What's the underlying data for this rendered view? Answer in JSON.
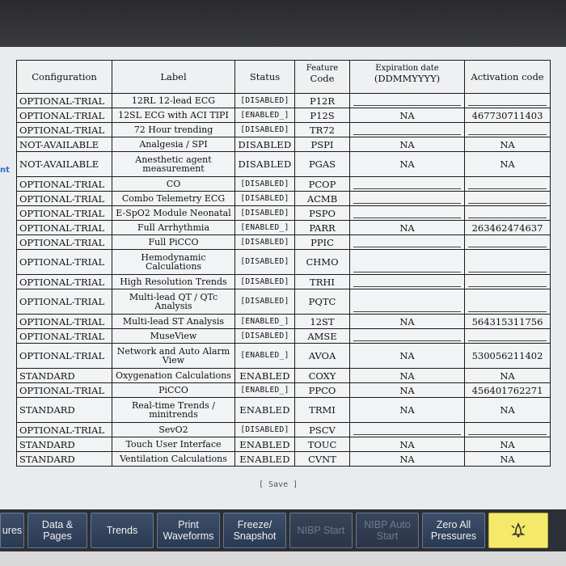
{
  "side_label": "nt",
  "columns": {
    "configuration": "Configuration",
    "label": "Label",
    "status": "Status",
    "feature_code_top": "Feature",
    "feature_code": "Code",
    "expiration_top": "Expiration date",
    "expiration": "(DDMMYYYY)",
    "activation": "Activation code"
  },
  "rows": [
    {
      "cfg": "OPTIONAL-TRIAL",
      "label": "12RL 12-lead ECG",
      "status": "[DISABLED]",
      "code": "P12R",
      "exp": "",
      "act": ""
    },
    {
      "cfg": "OPTIONAL-TRIAL",
      "label": "12SL ECG with ACI TIPI",
      "status": "[ENABLED_]",
      "code": "P12S",
      "exp": "NA",
      "act": "467730711403"
    },
    {
      "cfg": "OPTIONAL-TRIAL",
      "label": "72 Hour trending",
      "status": "[DISABLED]",
      "code": "TR72",
      "exp": "",
      "act": ""
    },
    {
      "cfg": "NOT-AVAILABLE",
      "label": "Analgesia / SPI",
      "status": "DISABLED",
      "code": "PSPI",
      "exp": "NA",
      "act": "NA"
    },
    {
      "cfg": "NOT-AVAILABLE",
      "label": "Anesthetic agent measurement",
      "status": "DISABLED",
      "code": "PGAS",
      "exp": "NA",
      "act": "NA"
    },
    {
      "cfg": "OPTIONAL-TRIAL",
      "label": "CO",
      "status": "[DISABLED]",
      "code": "PCOP",
      "exp": "",
      "act": ""
    },
    {
      "cfg": "OPTIONAL-TRIAL",
      "label": "Combo Telemetry ECG",
      "status": "[DISABLED]",
      "code": "ACMB",
      "exp": "",
      "act": ""
    },
    {
      "cfg": "OPTIONAL-TRIAL",
      "label": "E-SpO2 Module Neonatal",
      "status": "[DISABLED]",
      "code": "PSPO",
      "exp": "",
      "act": ""
    },
    {
      "cfg": "OPTIONAL-TRIAL",
      "label": "Full Arrhythmia",
      "status": "[ENABLED_]",
      "code": "PARR",
      "exp": "NA",
      "act": "263462474637"
    },
    {
      "cfg": "OPTIONAL-TRIAL",
      "label": "Full PiCCO",
      "status": "[DISABLED]",
      "code": "PPIC",
      "exp": "",
      "act": ""
    },
    {
      "cfg": "OPTIONAL-TRIAL",
      "label": "Hemodynamic Calculations",
      "status": "[DISABLED]",
      "code": "CHMO",
      "exp": "",
      "act": ""
    },
    {
      "cfg": "OPTIONAL-TRIAL",
      "label": "High Resolution Trends",
      "status": "[DISABLED]",
      "code": "TRHI",
      "exp": "",
      "act": ""
    },
    {
      "cfg": "OPTIONAL-TRIAL",
      "label": "Multi-lead QT / QTc Analysis",
      "status": "[DISABLED]",
      "code": "PQTC",
      "exp": "",
      "act": ""
    },
    {
      "cfg": "OPTIONAL-TRIAL",
      "label": "Multi-lead ST Analysis",
      "status": "[ENABLED_]",
      "code": "12ST",
      "exp": "NA",
      "act": "564315311756"
    },
    {
      "cfg": "OPTIONAL-TRIAL",
      "label": "MuseView",
      "status": "[DISABLED]",
      "code": "AMSE",
      "exp": "",
      "act": ""
    },
    {
      "cfg": "OPTIONAL-TRIAL",
      "label": "Network and Auto Alarm View",
      "status": "[ENABLED_]",
      "code": "AVOA",
      "exp": "NA",
      "act": "530056211402"
    },
    {
      "cfg": "STANDARD",
      "label": "Oxygenation Calculations",
      "status": "ENABLED",
      "code": "COXY",
      "exp": "NA",
      "act": "NA"
    },
    {
      "cfg": "OPTIONAL-TRIAL",
      "label": "PiCCO",
      "status": "[ENABLED_]",
      "code": "PPCO",
      "exp": "NA",
      "act": "456401762271"
    },
    {
      "cfg": "STANDARD",
      "label": "Real-time Trends / minitrends",
      "status": "ENABLED",
      "code": "TRMI",
      "exp": "NA",
      "act": "NA"
    },
    {
      "cfg": "OPTIONAL-TRIAL",
      "label": "SevO2",
      "status": "[DISABLED]",
      "code": "PSCV",
      "exp": "",
      "act": ""
    },
    {
      "cfg": "STANDARD",
      "label": "Touch User Interface",
      "status": "ENABLED",
      "code": "TOUC",
      "exp": "NA",
      "act": "NA"
    },
    {
      "cfg": "STANDARD",
      "label": "Ventilation Calculations",
      "status": "ENABLED",
      "code": "CVNT",
      "exp": "NA",
      "act": "NA"
    }
  ],
  "save_label": "[ Save ]",
  "toolbar": [
    {
      "label": "ures",
      "width": 30,
      "state": "normal"
    },
    {
      "label": "Data & Pages",
      "width": 74,
      "state": "normal"
    },
    {
      "label": "Trends",
      "width": 78,
      "state": "normal"
    },
    {
      "label": "Print Waveforms",
      "width": 78,
      "state": "normal"
    },
    {
      "label": "Freeze/ Snapshot",
      "width": 78,
      "state": "normal"
    },
    {
      "label": "NIBP Start",
      "width": 78,
      "state": "disabled"
    },
    {
      "label": "NIBP Auto Start",
      "width": 78,
      "state": "disabled"
    },
    {
      "label": "Zero All Pressures",
      "width": 78,
      "state": "normal"
    },
    {
      "label": "",
      "width": 74,
      "state": "alarm",
      "icon": "alarm-bell-icon"
    }
  ]
}
